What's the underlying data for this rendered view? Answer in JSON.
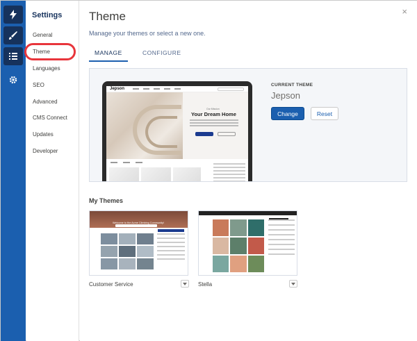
{
  "settings": {
    "title": "Settings",
    "nav": [
      {
        "label": "General"
      },
      {
        "label": "Theme"
      },
      {
        "label": "Languages"
      },
      {
        "label": "SEO"
      },
      {
        "label": "Advanced"
      },
      {
        "label": "CMS Connect"
      },
      {
        "label": "Updates"
      },
      {
        "label": "Developer"
      }
    ]
  },
  "rail": {
    "icons": [
      "lightning-icon",
      "brush-icon",
      "list-icon",
      "gear-icon"
    ],
    "colors": {
      "rail": "#1b5faf",
      "rail_button": "#16325c"
    }
  },
  "main": {
    "title": "Theme",
    "subtitle": "Manage your themes or select a new one.",
    "close_glyph": "×",
    "tabs": [
      {
        "label": "MANAGE",
        "active": true
      },
      {
        "label": "CONFIGURE",
        "active": false
      }
    ]
  },
  "current_theme": {
    "label": "CURRENT THEME",
    "name": "Jepson",
    "change_label": "Change",
    "reset_label": "Reset",
    "preview": {
      "logo": "Jepson",
      "eyebrow": "Our Mission",
      "headline": "Your Dream Home"
    }
  },
  "my_themes": {
    "title": "My Themes",
    "items": [
      {
        "name": "Customer Service",
        "preview_title": "Welcome to the Acme Climbing Community!"
      },
      {
        "name": "Stella"
      }
    ]
  },
  "colors": {
    "accent": "#1b5faf",
    "highlight": "#e8353b"
  }
}
